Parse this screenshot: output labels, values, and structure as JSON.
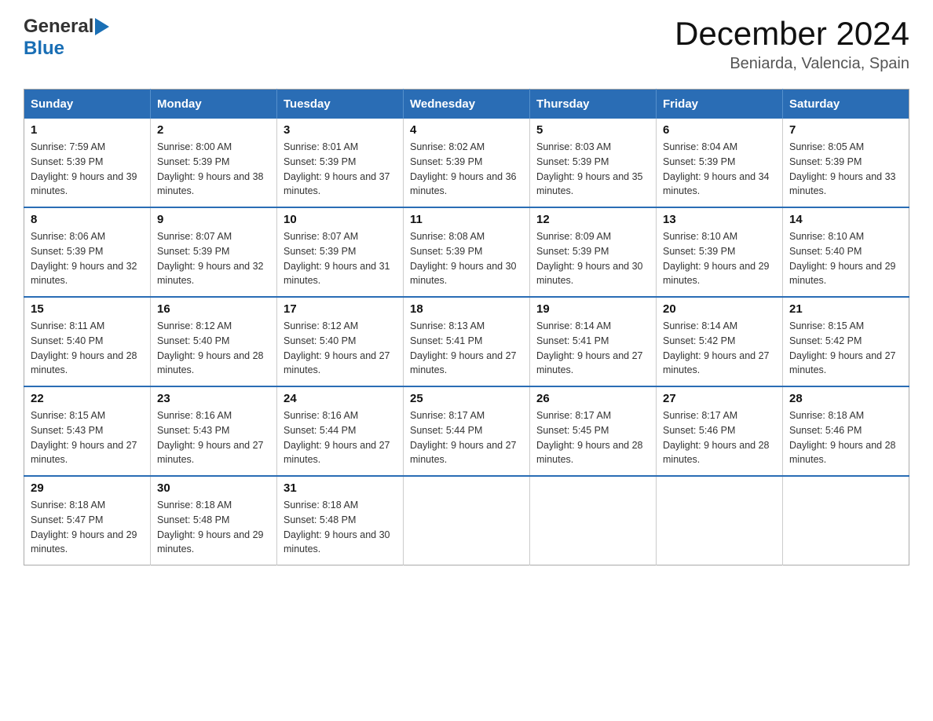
{
  "logo": {
    "general": "General",
    "blue": "Blue",
    "triangle_color": "#1a6fb5"
  },
  "header": {
    "title": "December 2024",
    "subtitle": "Beniarda, Valencia, Spain"
  },
  "calendar": {
    "days_of_week": [
      "Sunday",
      "Monday",
      "Tuesday",
      "Wednesday",
      "Thursday",
      "Friday",
      "Saturday"
    ],
    "weeks": [
      [
        {
          "day": "1",
          "sunrise": "Sunrise: 7:59 AM",
          "sunset": "Sunset: 5:39 PM",
          "daylight": "Daylight: 9 hours and 39 minutes."
        },
        {
          "day": "2",
          "sunrise": "Sunrise: 8:00 AM",
          "sunset": "Sunset: 5:39 PM",
          "daylight": "Daylight: 9 hours and 38 minutes."
        },
        {
          "day": "3",
          "sunrise": "Sunrise: 8:01 AM",
          "sunset": "Sunset: 5:39 PM",
          "daylight": "Daylight: 9 hours and 37 minutes."
        },
        {
          "day": "4",
          "sunrise": "Sunrise: 8:02 AM",
          "sunset": "Sunset: 5:39 PM",
          "daylight": "Daylight: 9 hours and 36 minutes."
        },
        {
          "day": "5",
          "sunrise": "Sunrise: 8:03 AM",
          "sunset": "Sunset: 5:39 PM",
          "daylight": "Daylight: 9 hours and 35 minutes."
        },
        {
          "day": "6",
          "sunrise": "Sunrise: 8:04 AM",
          "sunset": "Sunset: 5:39 PM",
          "daylight": "Daylight: 9 hours and 34 minutes."
        },
        {
          "day": "7",
          "sunrise": "Sunrise: 8:05 AM",
          "sunset": "Sunset: 5:39 PM",
          "daylight": "Daylight: 9 hours and 33 minutes."
        }
      ],
      [
        {
          "day": "8",
          "sunrise": "Sunrise: 8:06 AM",
          "sunset": "Sunset: 5:39 PM",
          "daylight": "Daylight: 9 hours and 32 minutes."
        },
        {
          "day": "9",
          "sunrise": "Sunrise: 8:07 AM",
          "sunset": "Sunset: 5:39 PM",
          "daylight": "Daylight: 9 hours and 32 minutes."
        },
        {
          "day": "10",
          "sunrise": "Sunrise: 8:07 AM",
          "sunset": "Sunset: 5:39 PM",
          "daylight": "Daylight: 9 hours and 31 minutes."
        },
        {
          "day": "11",
          "sunrise": "Sunrise: 8:08 AM",
          "sunset": "Sunset: 5:39 PM",
          "daylight": "Daylight: 9 hours and 30 minutes."
        },
        {
          "day": "12",
          "sunrise": "Sunrise: 8:09 AM",
          "sunset": "Sunset: 5:39 PM",
          "daylight": "Daylight: 9 hours and 30 minutes."
        },
        {
          "day": "13",
          "sunrise": "Sunrise: 8:10 AM",
          "sunset": "Sunset: 5:39 PM",
          "daylight": "Daylight: 9 hours and 29 minutes."
        },
        {
          "day": "14",
          "sunrise": "Sunrise: 8:10 AM",
          "sunset": "Sunset: 5:40 PM",
          "daylight": "Daylight: 9 hours and 29 minutes."
        }
      ],
      [
        {
          "day": "15",
          "sunrise": "Sunrise: 8:11 AM",
          "sunset": "Sunset: 5:40 PM",
          "daylight": "Daylight: 9 hours and 28 minutes."
        },
        {
          "day": "16",
          "sunrise": "Sunrise: 8:12 AM",
          "sunset": "Sunset: 5:40 PM",
          "daylight": "Daylight: 9 hours and 28 minutes."
        },
        {
          "day": "17",
          "sunrise": "Sunrise: 8:12 AM",
          "sunset": "Sunset: 5:40 PM",
          "daylight": "Daylight: 9 hours and 27 minutes."
        },
        {
          "day": "18",
          "sunrise": "Sunrise: 8:13 AM",
          "sunset": "Sunset: 5:41 PM",
          "daylight": "Daylight: 9 hours and 27 minutes."
        },
        {
          "day": "19",
          "sunrise": "Sunrise: 8:14 AM",
          "sunset": "Sunset: 5:41 PM",
          "daylight": "Daylight: 9 hours and 27 minutes."
        },
        {
          "day": "20",
          "sunrise": "Sunrise: 8:14 AM",
          "sunset": "Sunset: 5:42 PM",
          "daylight": "Daylight: 9 hours and 27 minutes."
        },
        {
          "day": "21",
          "sunrise": "Sunrise: 8:15 AM",
          "sunset": "Sunset: 5:42 PM",
          "daylight": "Daylight: 9 hours and 27 minutes."
        }
      ],
      [
        {
          "day": "22",
          "sunrise": "Sunrise: 8:15 AM",
          "sunset": "Sunset: 5:43 PM",
          "daylight": "Daylight: 9 hours and 27 minutes."
        },
        {
          "day": "23",
          "sunrise": "Sunrise: 8:16 AM",
          "sunset": "Sunset: 5:43 PM",
          "daylight": "Daylight: 9 hours and 27 minutes."
        },
        {
          "day": "24",
          "sunrise": "Sunrise: 8:16 AM",
          "sunset": "Sunset: 5:44 PM",
          "daylight": "Daylight: 9 hours and 27 minutes."
        },
        {
          "day": "25",
          "sunrise": "Sunrise: 8:17 AM",
          "sunset": "Sunset: 5:44 PM",
          "daylight": "Daylight: 9 hours and 27 minutes."
        },
        {
          "day": "26",
          "sunrise": "Sunrise: 8:17 AM",
          "sunset": "Sunset: 5:45 PM",
          "daylight": "Daylight: 9 hours and 28 minutes."
        },
        {
          "day": "27",
          "sunrise": "Sunrise: 8:17 AM",
          "sunset": "Sunset: 5:46 PM",
          "daylight": "Daylight: 9 hours and 28 minutes."
        },
        {
          "day": "28",
          "sunrise": "Sunrise: 8:18 AM",
          "sunset": "Sunset: 5:46 PM",
          "daylight": "Daylight: 9 hours and 28 minutes."
        }
      ],
      [
        {
          "day": "29",
          "sunrise": "Sunrise: 8:18 AM",
          "sunset": "Sunset: 5:47 PM",
          "daylight": "Daylight: 9 hours and 29 minutes."
        },
        {
          "day": "30",
          "sunrise": "Sunrise: 8:18 AM",
          "sunset": "Sunset: 5:48 PM",
          "daylight": "Daylight: 9 hours and 29 minutes."
        },
        {
          "day": "31",
          "sunrise": "Sunrise: 8:18 AM",
          "sunset": "Sunset: 5:48 PM",
          "daylight": "Daylight: 9 hours and 30 minutes."
        },
        null,
        null,
        null,
        null
      ]
    ]
  }
}
